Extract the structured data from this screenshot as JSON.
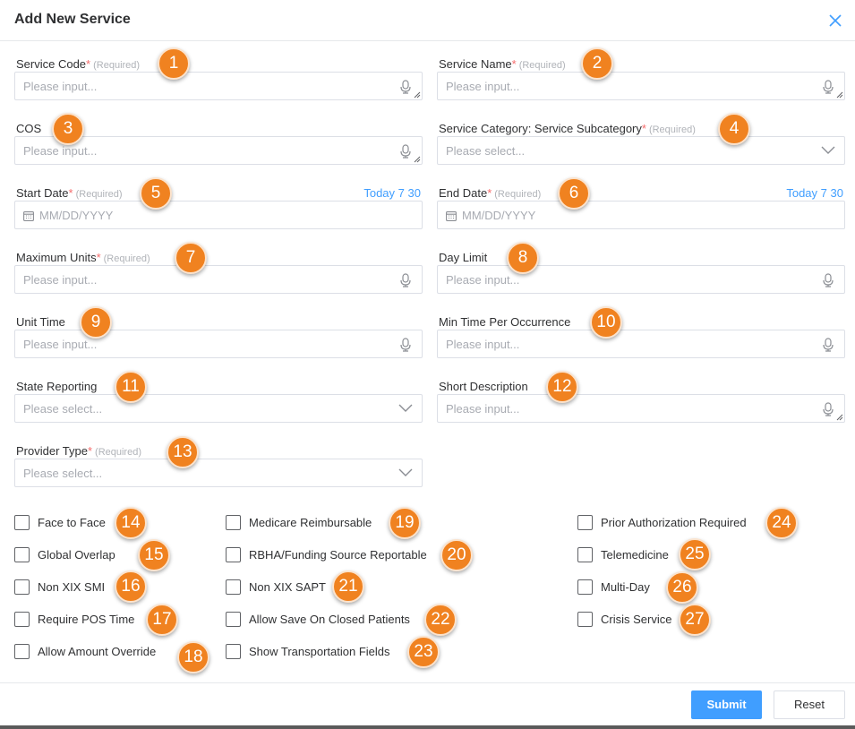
{
  "dialog": {
    "title": "Add New Service",
    "close_icon": "close-icon"
  },
  "fields": {
    "service_code": {
      "label": "Service Code",
      "star": "*",
      "req": "(Required)",
      "placeholder": "Please input..."
    },
    "service_name": {
      "label": "Service Name",
      "star": "*",
      "req": "(Required)",
      "placeholder": "Please input..."
    },
    "cos": {
      "label": "COS",
      "placeholder": "Please input..."
    },
    "service_category": {
      "label": "Service Category: Service Subcategory",
      "star": "*",
      "req": "(Required)",
      "placeholder": "Please select..."
    },
    "start_date": {
      "label": "Start Date",
      "star": "*",
      "req": "(Required)",
      "today": "Today",
      "days1": "7",
      "days2": "30",
      "placeholder": "MM/DD/YYYY"
    },
    "end_date": {
      "label": "End Date",
      "star": "*",
      "req": "(Required)",
      "today": "Today",
      "days1": "7",
      "days2": "30",
      "placeholder": "MM/DD/YYYY"
    },
    "maximum_units": {
      "label": "Maximum Units",
      "star": "*",
      "req": "(Required)",
      "placeholder": "Please input..."
    },
    "day_limit": {
      "label": "Day Limit",
      "placeholder": "Please input..."
    },
    "unit_time": {
      "label": "Unit Time",
      "placeholder": "Please input..."
    },
    "min_time": {
      "label": "Min Time Per Occurrence",
      "placeholder": "Please input..."
    },
    "state_reporting": {
      "label": "State Reporting",
      "placeholder": "Please select..."
    },
    "short_description": {
      "label": "Short Description",
      "placeholder": "Please input..."
    },
    "provider_type": {
      "label": "Provider Type",
      "star": "*",
      "req": "(Required)",
      "placeholder": "Please select..."
    }
  },
  "checkboxes": [
    "Face to Face",
    "Global Overlap",
    "Non XIX SMI",
    "Require POS Time",
    "Allow Amount Override",
    "Medicare Reimbursable",
    "RBHA/Funding Source Reportable",
    "Non XIX SAPT",
    "Allow Save On Closed Patients",
    "Show Transportation Fields",
    "Prior Authorization Required",
    "Telemedicine",
    "Multi-Day",
    "Crisis Service"
  ],
  "badges": [
    "1",
    "2",
    "3",
    "4",
    "5",
    "6",
    "7",
    "8",
    "9",
    "10",
    "11",
    "12",
    "13",
    "14",
    "15",
    "16",
    "17",
    "18",
    "19",
    "20",
    "21",
    "22",
    "23",
    "24",
    "25",
    "26",
    "27"
  ],
  "footer": {
    "submit": "Submit",
    "reset": "Reset"
  },
  "colors": {
    "primary": "#409eff",
    "required_star": "#f56c6c",
    "badge": "#f08220"
  }
}
